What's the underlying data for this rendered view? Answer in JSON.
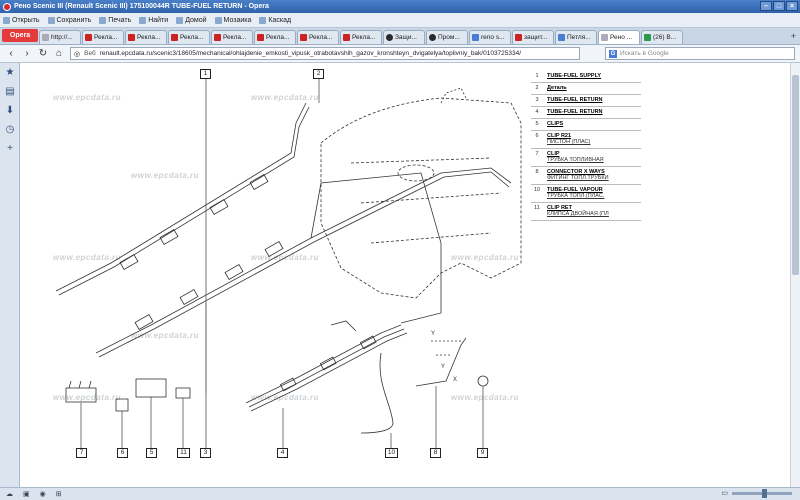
{
  "window": {
    "title": "Рено Scenic III (Renault Scenic III) 175100044R TUBE-FUEL RETURN - Opera"
  },
  "menubar": {
    "items": [
      {
        "label": "Открыть"
      },
      {
        "label": "Сохранить"
      },
      {
        "label": "Печать"
      },
      {
        "label": "Найти"
      },
      {
        "label": "Домой"
      },
      {
        "label": "Мозаика"
      },
      {
        "label": "Каскад"
      }
    ]
  },
  "tabs": {
    "opera_label": "Opera",
    "items": [
      {
        "label": "http://...",
        "fav": "n"
      },
      {
        "label": "Рекла...",
        "fav": "d"
      },
      {
        "label": "Рекла...",
        "fav": "d"
      },
      {
        "label": "Рекла...",
        "fav": "d"
      },
      {
        "label": "Рекла...",
        "fav": "d"
      },
      {
        "label": "Рекла...",
        "fav": "d"
      },
      {
        "label": "Рекла...",
        "fav": "d"
      },
      {
        "label": "Рекла...",
        "fav": "d"
      },
      {
        "label": "Защи...",
        "fav": "w"
      },
      {
        "label": "Пром...",
        "fav": "w"
      },
      {
        "label": "reno s...",
        "fav": "g"
      },
      {
        "label": "защит...",
        "fav": "d"
      },
      {
        "label": "Петля...",
        "fav": "g"
      },
      {
        "label": "Рено ...",
        "fav": "n",
        "active": true
      },
      {
        "label": "(26) В...",
        "fav": "b"
      }
    ]
  },
  "addressbar": {
    "ssl_label": "Веб",
    "url": "renault.epcdata.ru/scenic3/18605/mechanical/ohlajdenie_emkosti_vipusk_otrabotavshih_gazov_kronshteyn_dvigatelya/toplivniy_bak/0103725334/",
    "search_placeholder": "Искать в Google",
    "search_engine": "G"
  },
  "watermark": "www.epcdata.ru",
  "parts": [
    {
      "num": "1",
      "name": "TUBE-FUEL SUPPLY",
      "sub": ""
    },
    {
      "num": "2",
      "name": "Деталь",
      "sub": ""
    },
    {
      "num": "3",
      "name": "TUBE-FUEL RETURN",
      "sub": ""
    },
    {
      "num": "4",
      "name": "TUBE-FUEL RETURN",
      "sub": ""
    },
    {
      "num": "5",
      "name": "CLIPS",
      "sub": ""
    },
    {
      "num": "6",
      "name": "CLIP R21",
      "sub": "ПИСТОН (ПЛАС)"
    },
    {
      "num": "7",
      "name": "CLIP",
      "sub": "ТРУБКА ТОПЛИВНАЯ"
    },
    {
      "num": "8",
      "name": "CONNECTOR X WAYS",
      "sub": "ФИТИНГ ТОПЛ.ТРУБКИ"
    },
    {
      "num": "10",
      "name": "TUBE-FUEL VAPOUR",
      "sub": "ТРУБКА ТОПЛ.(ПЛАС."
    },
    {
      "num": "11",
      "name": "CLIP RET",
      "sub": "КЛИПСА ДВОЙНАЯ (ПЛ"
    }
  ],
  "callouts": [
    "1",
    "2",
    "3",
    "4",
    "5",
    "6",
    "7",
    "8",
    "9",
    "10",
    "11"
  ],
  "detail_labels": [
    "Y",
    "Y",
    "X"
  ]
}
